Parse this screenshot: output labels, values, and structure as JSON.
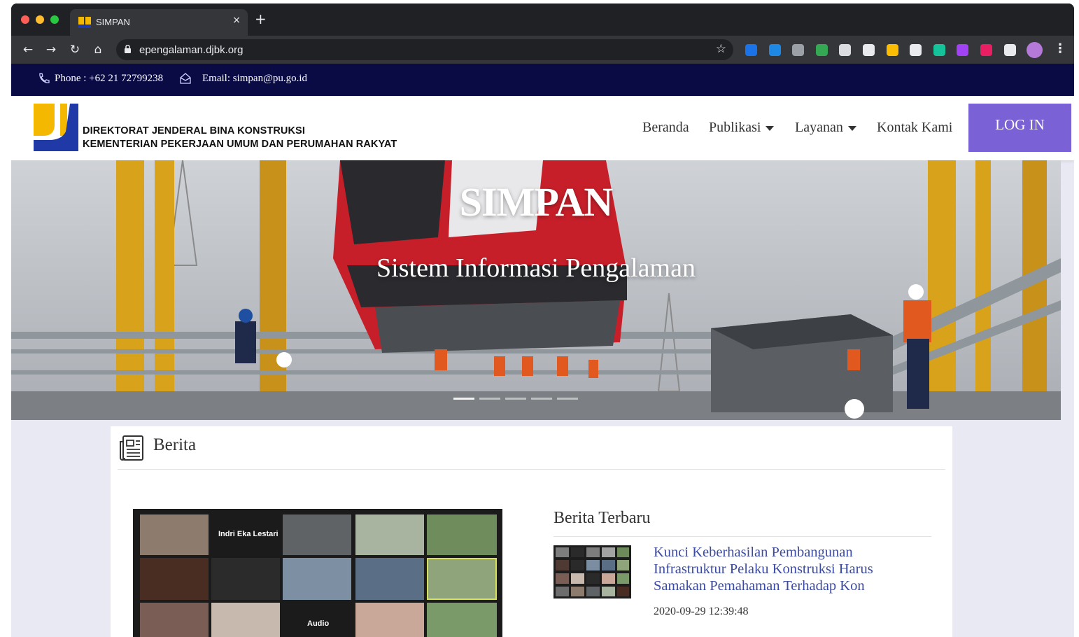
{
  "browser": {
    "tab_title": "SIMPAN",
    "tab_close": "×",
    "new_tab": "+",
    "url": "epengalaman.djbk.org",
    "nav": {
      "back": "←",
      "forward": "→",
      "reload": "↻",
      "home": "⌂"
    },
    "bookmark_icon": "☆",
    "menu_icon": "⋮",
    "extension_icons": [
      "s-extension-icon",
      "cube-extension-icon",
      "shield-extension-icon",
      "leaf-extension-icon",
      "glasses-extension-icon",
      "printer-extension-icon",
      "image-extension-icon",
      "check-extension-icon",
      "grammarly-extension-icon",
      "purple-extension-icon",
      "magenta-extension-icon",
      "puzzle-extension-icon"
    ],
    "extension_colors": [
      "#1a73e8",
      "#1e88e5",
      "#9aa0a6",
      "#34a853",
      "#dadce0",
      "#e8eaed",
      "#fbbc04",
      "#e8eaed",
      "#15c39a",
      "#a142f4",
      "#e91e63",
      "#e8eaed"
    ]
  },
  "topbar": {
    "phone": "Phone : +62 21 72799238",
    "email": "Email: simpan@pu.go.id"
  },
  "header": {
    "org_line1": "DIREKTORAT JENDERAL BINA KONSTRUKSI",
    "org_line2": "KEMENTERIAN PEKERJAAN UMUM DAN PERUMAHAN RAKYAT",
    "menu": {
      "home": "Beranda",
      "publications": "Publikasi",
      "services": "Layanan",
      "contact": "Kontak Kami"
    },
    "login": "LOG IN"
  },
  "hero": {
    "title": "SIMPAN",
    "subtitle": "Sistem Informasi Pengalaman"
  },
  "news": {
    "heading": "Berita",
    "latest_heading": "Berita Terbaru",
    "video_participants": {
      "featured": "Indri Eka Lestari",
      "audio": "Audio"
    },
    "article": {
      "title": "Kunci Keberhasilan Pembangunan Infrastruktur Pelaku Konstruksi Harus Samakan Pemahaman Terhadap Kon",
      "date": "2020-09-29 12:39:48"
    }
  },
  "colors": {
    "topbar_bg": "#0a0a45",
    "login_bg": "#7b61d6",
    "link": "#3b4aa2",
    "page_bg": "#e9e9f4"
  }
}
